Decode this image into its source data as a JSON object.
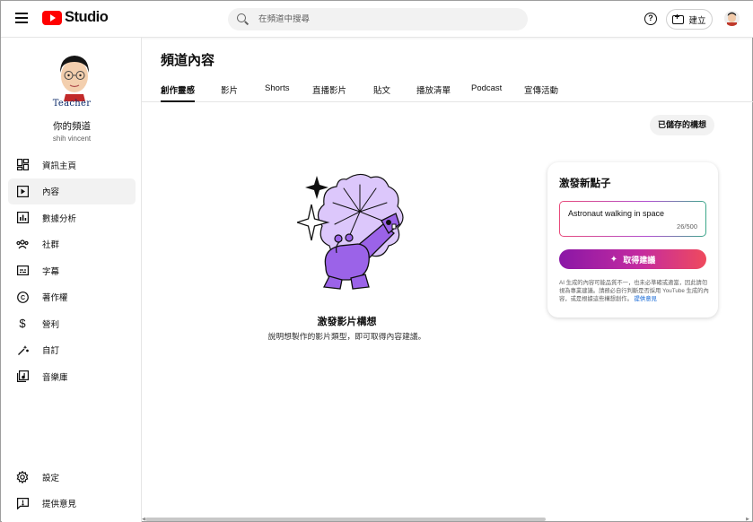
{
  "header": {
    "logo_text": "Studio",
    "search_placeholder": "在頻道中搜尋",
    "help_icon": "help-circle-icon",
    "create_label": "建立"
  },
  "sidebar": {
    "avatar_label": "Teacher",
    "channel_name": "你的頻道",
    "channel_handle": "shih vincent",
    "items": [
      {
        "label": "資訊主頁",
        "icon": "dashboard-icon",
        "glyph": "▦"
      },
      {
        "label": "內容",
        "icon": "content-icon",
        "glyph": "▶",
        "active": true
      },
      {
        "label": "數據分析",
        "icon": "analytics-icon",
        "glyph": "▥"
      },
      {
        "label": "社群",
        "icon": "community-icon",
        "glyph": "⚇"
      },
      {
        "label": "字幕",
        "icon": "subtitles-icon",
        "glyph": "▤"
      },
      {
        "label": "著作權",
        "icon": "copyright-icon",
        "glyph": "©"
      },
      {
        "label": "營利",
        "icon": "earn-icon",
        "glyph": "$"
      },
      {
        "label": "自訂",
        "icon": "customization-icon",
        "glyph": "✎"
      },
      {
        "label": "音樂庫",
        "icon": "audio-library-icon",
        "glyph": "♫"
      }
    ],
    "bottom_items": [
      {
        "label": "設定",
        "icon": "settings-icon",
        "glyph": "⚙"
      },
      {
        "label": "提供意見",
        "icon": "feedback-icon",
        "glyph": "!"
      }
    ]
  },
  "main": {
    "title": "頻道內容",
    "tabs": [
      {
        "label": "創作靈感",
        "active": true
      },
      {
        "label": "影片"
      },
      {
        "label": "Shorts"
      },
      {
        "label": "直播影片"
      },
      {
        "label": "貼文"
      },
      {
        "label": "播放清單"
      },
      {
        "label": "Podcast"
      },
      {
        "label": "宣傳活動"
      }
    ],
    "saved_ideas_label": "已儲存的構想",
    "empty_title": "激發影片構想",
    "empty_subtitle": "說明想製作的影片類型，即可取得內容建議。"
  },
  "card": {
    "title": "激發新點子",
    "idea_text": "Astronaut walking in space",
    "char_count": "26/500",
    "button_label": "取得建議",
    "disclaimer": "AI 生成的內容可能品質不一，也未必準確或適當，因此請勿視為專業建議。請務必自行判斷是否採用 YouTube 生成的內容，或是根據這些構想創作。",
    "feedback_link": "提供意見"
  },
  "colors": {
    "brand_red": "#ff0000",
    "gradient_start": "#8a17a6",
    "gradient_end": "#ef4a5d",
    "illustration_purple": "#9b63e8",
    "illustration_light": "#dcc7fb"
  }
}
